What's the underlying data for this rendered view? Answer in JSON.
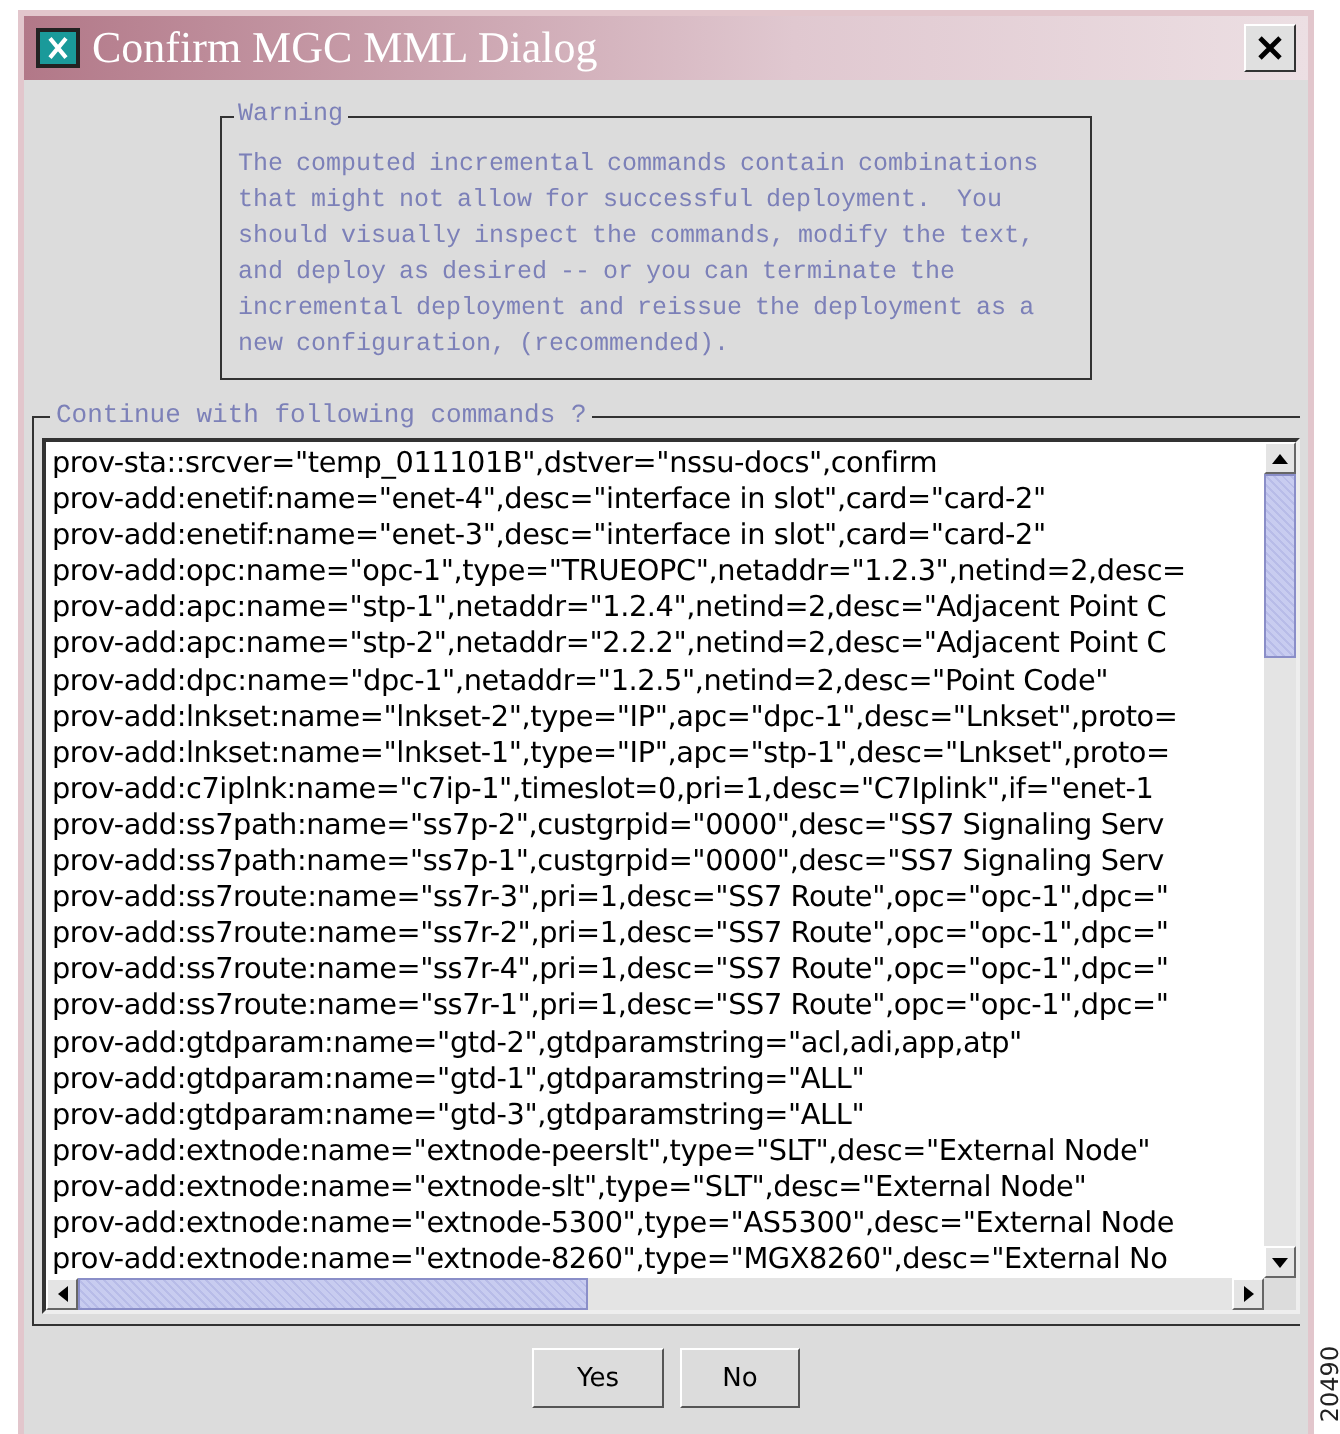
{
  "window": {
    "title": "Confirm MGC MML Dialog"
  },
  "warning": {
    "legend": "Warning",
    "message": "The computed incremental commands contain combinations that might not allow for successful deployment.  You should visually inspect the commands, modify the text, and deploy as desired -- or you can terminate the incremental deployment and reissue the deployment as a new configuration, (recommended)."
  },
  "commands": {
    "legend": "Continue with following commands ?",
    "lines": [
      "prov-sta::srcver=\"temp_011101B\",dstver=\"nssu-docs\",confirm",
      "prov-add:enetif:name=\"enet-4\",desc=\"interface in slot\",card=\"card-2\"",
      "prov-add:enetif:name=\"enet-3\",desc=\"interface in slot\",card=\"card-2\"",
      "prov-add:opc:name=\"opc-1\",type=\"TRUEOPC\",netaddr=\"1.2.3\",netind=2,desc=",
      "prov-add:apc:name=\"stp-1\",netaddr=\"1.2.4\",netind=2,desc=\"Adjacent Point C",
      "prov-add:apc:name=\"stp-2\",netaddr=\"2.2.2\",netind=2,desc=\"Adjacent Point C",
      "prov-add:dpc:name=\"dpc-1\",netaddr=\"1.2.5\",netind=2,desc=\"Point Code\"",
      "prov-add:lnkset:name=\"lnkset-2\",type=\"IP\",apc=\"dpc-1\",desc=\"Lnkset\",proto=",
      "prov-add:lnkset:name=\"lnkset-1\",type=\"IP\",apc=\"stp-1\",desc=\"Lnkset\",proto=",
      "prov-add:c7iplnk:name=\"c7ip-1\",timeslot=0,pri=1,desc=\"C7Iplink\",if=\"enet-1",
      "prov-add:ss7path:name=\"ss7p-2\",custgrpid=\"0000\",desc=\"SS7 Signaling Serv",
      "prov-add:ss7path:name=\"ss7p-1\",custgrpid=\"0000\",desc=\"SS7 Signaling Serv",
      "prov-add:ss7route:name=\"ss7r-3\",pri=1,desc=\"SS7 Route\",opc=\"opc-1\",dpc=\"",
      "prov-add:ss7route:name=\"ss7r-2\",pri=1,desc=\"SS7 Route\",opc=\"opc-1\",dpc=\"",
      "prov-add:ss7route:name=\"ss7r-4\",pri=1,desc=\"SS7 Route\",opc=\"opc-1\",dpc=\"",
      "prov-add:ss7route:name=\"ss7r-1\",pri=1,desc=\"SS7 Route\",opc=\"opc-1\",dpc=\"",
      "prov-add:gtdparam:name=\"gtd-2\",gtdparamstring=\"acl,adi,app,atp\"",
      "prov-add:gtdparam:name=\"gtd-1\",gtdparamstring=\"ALL\"",
      "prov-add:gtdparam:name=\"gtd-3\",gtdparamstring=\"ALL\"",
      "prov-add:extnode:name=\"extnode-peerslt\",type=\"SLT\",desc=\"External Node\"",
      "prov-add:extnode:name=\"extnode-slt\",type=\"SLT\",desc=\"External Node\"",
      "prov-add:extnode:name=\"extnode-5300\",type=\"AS5300\",desc=\"External Node",
      "prov-add:extnode:name=\"extnode-8260\",type=\"MGX8260\",desc=\"External No"
    ]
  },
  "buttons": [
    "Yes",
    "No"
  ],
  "figure_number": "20490"
}
